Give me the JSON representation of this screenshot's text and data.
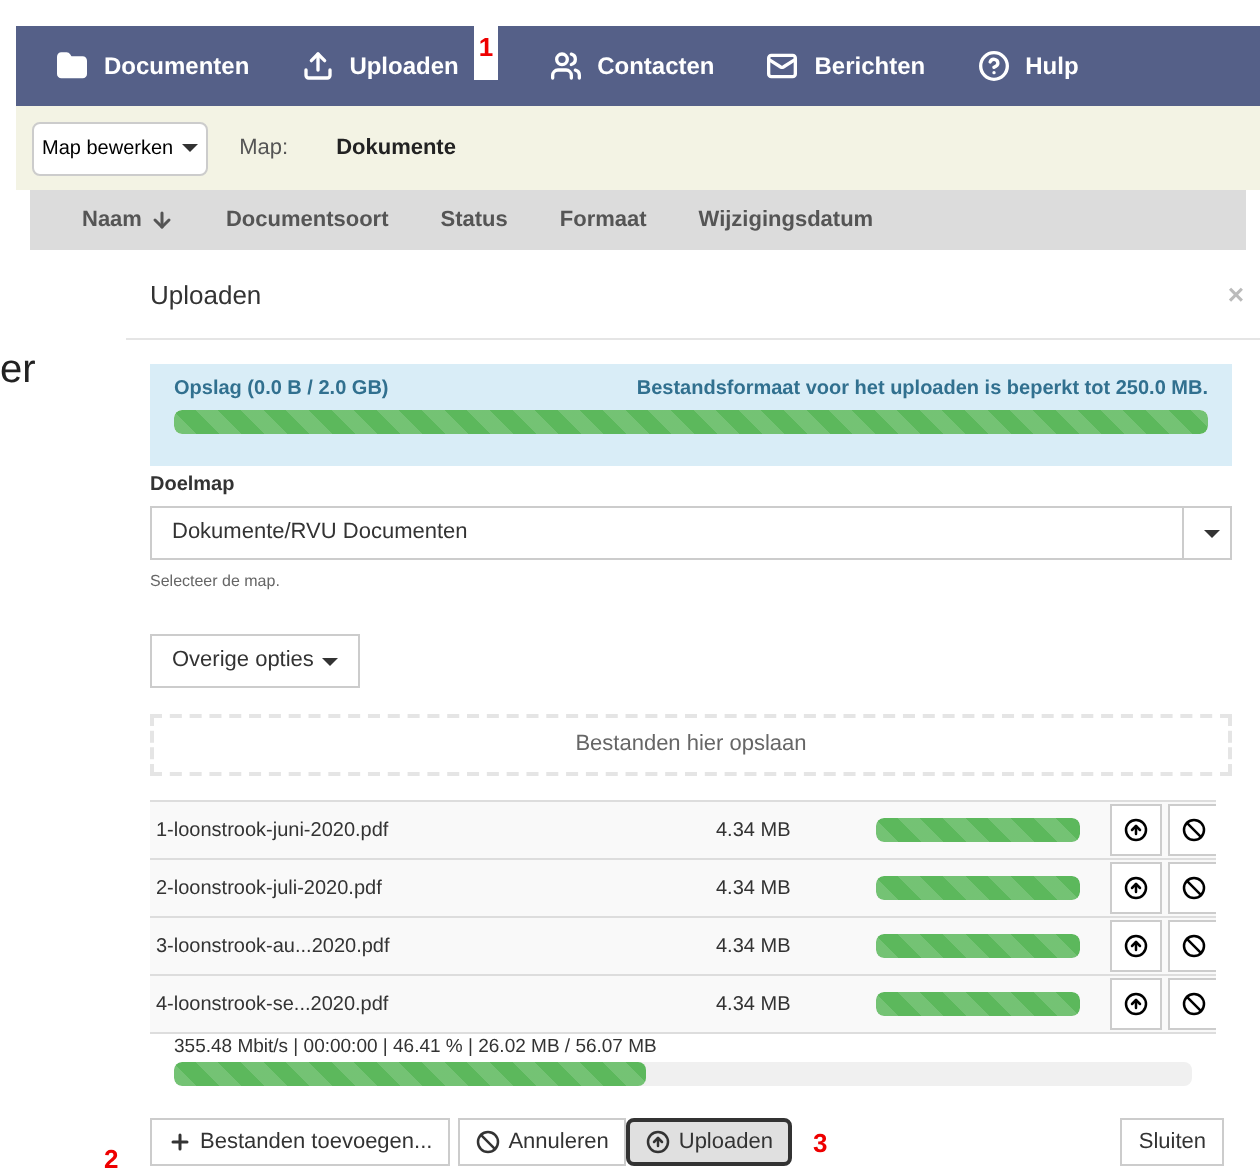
{
  "nav": {
    "items": [
      {
        "label": "Documenten",
        "kind": "folder"
      },
      {
        "label": "Uploaden",
        "kind": "upload"
      },
      {
        "label": "Contacten",
        "kind": "people"
      },
      {
        "label": "Berichten",
        "kind": "mail"
      },
      {
        "label": "Hulp",
        "kind": "help"
      }
    ]
  },
  "markers": [
    {
      "label": "1"
    },
    {
      "label": "2"
    },
    {
      "label": "3"
    }
  ],
  "toolbar": {
    "edit_button": "Map bewerken",
    "map_label": "Map:",
    "map_value": "Dokumente"
  },
  "table": {
    "columns": [
      {
        "label": "Naam",
        "sorted": true
      },
      {
        "label": "Documentsoort",
        "sorted": false
      },
      {
        "label": "Status",
        "sorted": false
      },
      {
        "label": "Formaat",
        "sorted": false
      },
      {
        "label": "Wijzigingsdatum",
        "sorted": false
      }
    ]
  },
  "background_fragment": "er",
  "dialog": {
    "title": "Uploaden",
    "close": "×",
    "storage": {
      "label": "Opslag (0.0 B / 2.0 GB)",
      "limit": "Bestandsformaat voor het uploaden is beperkt tot 250.0 MB.",
      "level": 1
    },
    "target": {
      "label": "Doelmap",
      "value": "Dokumente/RVU Documenten",
      "hint": "Selecteer de map."
    },
    "options_button": "Overige opties",
    "dropzone": "Bestanden hier opslaan",
    "files": [
      {
        "name": "1-loonstrook-juni-2020.pdf",
        "size": "4.34 MB",
        "level": 1
      },
      {
        "name": "2-loonstrook-juli-2020.pdf",
        "size": "4.34 MB",
        "level": 1
      },
      {
        "name": "3-loonstrook-au...2020.pdf",
        "size": "4.34 MB",
        "level": 1
      },
      {
        "name": "4-loonstrook-se...2020.pdf",
        "size": "4.34 MB",
        "level": 1
      }
    ],
    "stats": "355.48 Mbit/s | 00:00:00 | 46.41 % | 26.02 MB / 56.07 MB",
    "total": {
      "level": 0.4641
    },
    "buttons": [
      {
        "label": "Bestanden toevoegen...",
        "kind": "add",
        "selected": false
      },
      {
        "label": "Annuleren",
        "kind": "cancel",
        "selected": false
      },
      {
        "label": "Uploaden",
        "kind": "upload",
        "selected": true
      },
      {
        "label": "Sluiten",
        "kind": "close",
        "selected": false
      }
    ]
  }
}
